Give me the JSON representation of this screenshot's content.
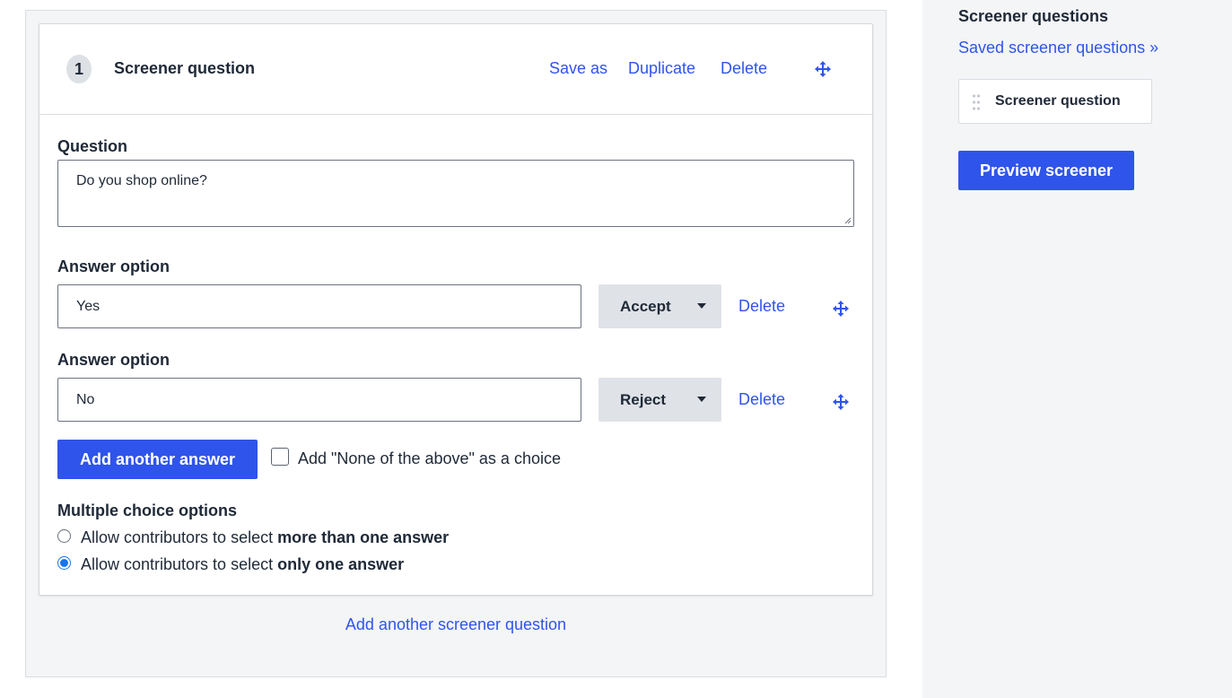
{
  "question": {
    "number": "1",
    "title": "Screener question",
    "actions": {
      "save_as": "Save as",
      "duplicate": "Duplicate",
      "delete": "Delete"
    },
    "question_label": "Question",
    "question_value": "Do you shop online?",
    "answers": [
      {
        "label": "Answer option",
        "value": "Yes",
        "outcome": "Accept",
        "delete": "Delete"
      },
      {
        "label": "Answer option",
        "value": "No",
        "outcome": "Reject",
        "delete": "Delete"
      }
    ],
    "add_answer_label": "Add another answer",
    "none_of_above_label": "Add \"None of the above\" as a choice",
    "none_of_above_checked": false,
    "multiple_choice": {
      "heading": "Multiple choice options",
      "options": [
        {
          "prefix": "Allow contributors to select ",
          "emphasis": "more than one answer",
          "checked": false
        },
        {
          "prefix": "Allow contributors to select ",
          "emphasis": "only one answer",
          "checked": true
        }
      ]
    }
  },
  "add_question_label": "Add another screener question",
  "sidebar": {
    "title": "Screener questions",
    "saved_link": "Saved screener questions »",
    "items": [
      {
        "label": "Screener question"
      }
    ],
    "preview_button": "Preview screener"
  },
  "icons": {
    "move": "move-arrows-icon",
    "drag": "drag-grip-icon",
    "caret": "caret-down-icon"
  },
  "colors": {
    "accent": "#2f54eb",
    "radio": "#1a73e8",
    "panel_bg": "#f4f5f7"
  }
}
